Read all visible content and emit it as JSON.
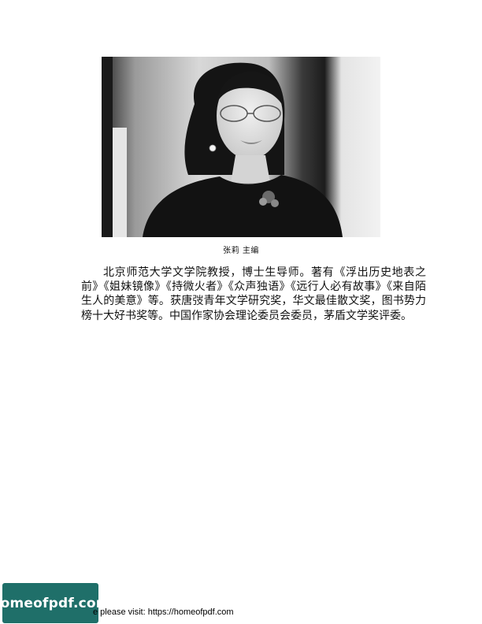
{
  "caption": "张莉 主编",
  "bio": "北京师范大学文学院教授，博士生导师。著有《浮出历史地表之前》《姐妹镜像》《持微火者》《众声独语》《远行人必有故事》《来自陌生人的美意》等。获唐弢青年文学研究奖，华文最佳散文奖，图书势力榜十大好书奖等。中国作家协会理论委员会委员，茅盾文学奖评委。",
  "watermark": {
    "logo_text": "homeofpdf.com",
    "visit_text": "e please visit: https://homeofpdf.com",
    "badge_color": "#1f6f69"
  }
}
